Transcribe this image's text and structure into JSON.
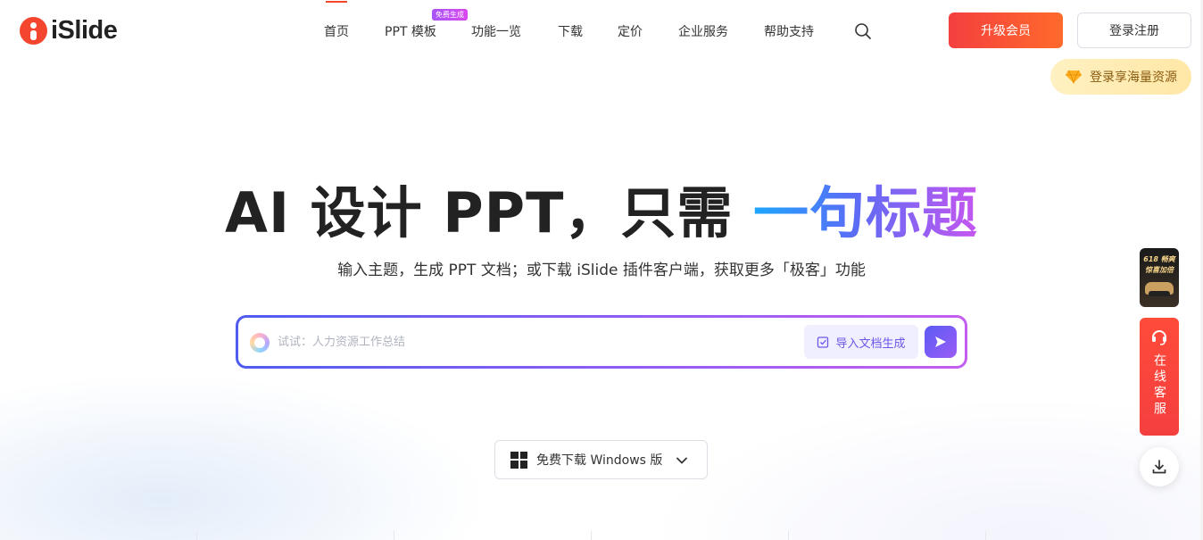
{
  "brand": {
    "logo_text": "iSlide"
  },
  "nav": {
    "items": [
      {
        "label": "首页",
        "active": true
      },
      {
        "label": "PPT 模板"
      },
      {
        "label": "功能一览"
      },
      {
        "label": "下载"
      },
      {
        "label": "定价"
      },
      {
        "label": "企业服务"
      },
      {
        "label": "帮助支持"
      }
    ],
    "badge": "免费生成"
  },
  "header": {
    "upgrade_label": "升级会员",
    "login_label": "登录注册",
    "login_tip": "登录享海量资源"
  },
  "hero": {
    "title_plain": "AI 设计 PPT，只需",
    "title_highlight": "一句标题",
    "subtitle": "输入主题，生成 PPT 文档；或下载 iSlide 插件客户端，获取更多「极客」功能"
  },
  "search": {
    "placeholder": "试试：人力资源工作总结",
    "value": "",
    "import_label": "导入文档生成"
  },
  "download": {
    "label": "免费下载 Windows 版"
  },
  "float": {
    "promo_text": "618 畅爽 惊喜加倍",
    "cs_label": "在线客服"
  },
  "colors": {
    "brand_red": "#f4462f",
    "accent_purple": "#8b5cf6",
    "gradient_blue": "#1da6ff"
  }
}
